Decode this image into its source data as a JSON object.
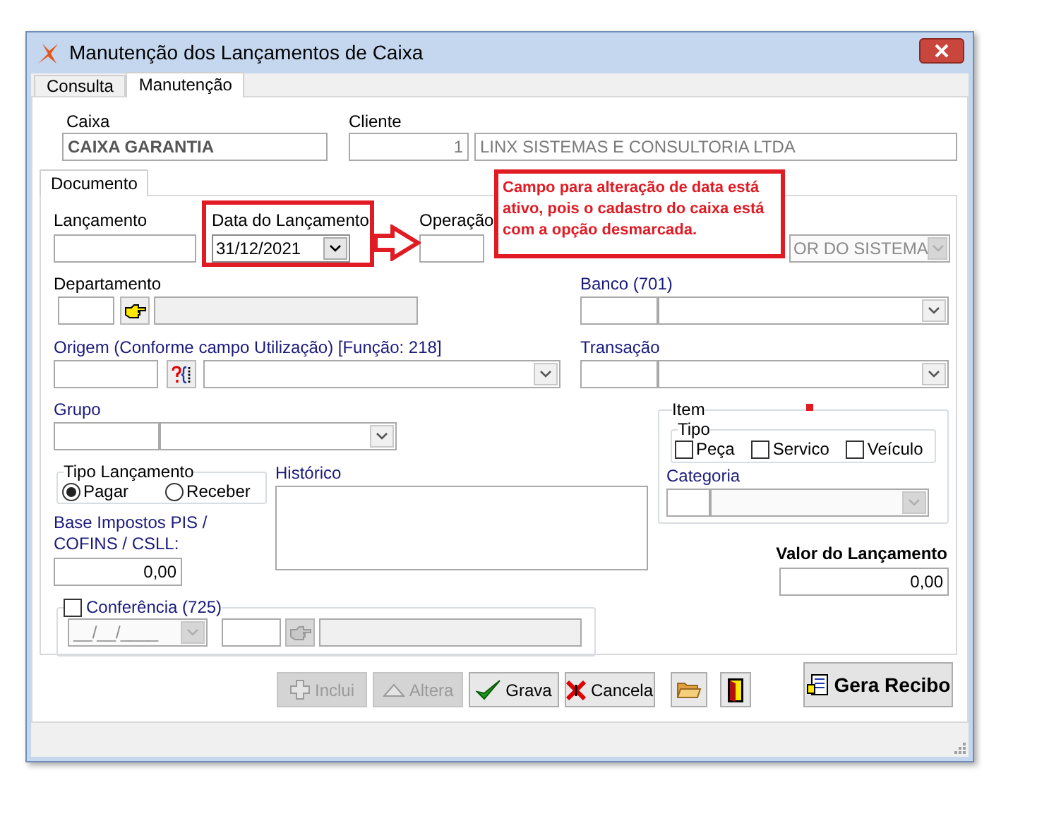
{
  "window": {
    "title": "Manutenção dos Lançamentos de Caixa"
  },
  "tabs": [
    {
      "label": "Consulta",
      "selected": false
    },
    {
      "label": "Manutenção",
      "selected": true
    }
  ],
  "caixa": {
    "label": "Caixa",
    "value": "CAIXA GARANTIA"
  },
  "cliente": {
    "label": "Cliente",
    "code": "1",
    "name": "LINX SISTEMAS E CONSULTORIA LTDA"
  },
  "inner_tabs": [
    {
      "label": "Documento",
      "selected": true
    }
  ],
  "lancamento": {
    "label": "Lançamento"
  },
  "data_lancamento": {
    "label": "Data do Lançamento",
    "value": "31/12/2021"
  },
  "operacao": {
    "label": "Operação",
    "value": "OR DO SISTEMA",
    "disabled": true
  },
  "departamento": {
    "label": "Departamento"
  },
  "banco": {
    "label": "Banco (701)"
  },
  "origem": {
    "label": "Origem (Conforme campo Utilização) [Função: 218]"
  },
  "transacao": {
    "label": "Transação"
  },
  "grupo": {
    "label": "Grupo"
  },
  "item": {
    "title": "Item",
    "tipo_title": "Tipo",
    "categoria_label": "Categoria",
    "categoria_disabled": true,
    "tipo": [
      {
        "label": "Peça",
        "checked": false
      },
      {
        "label": "Servico",
        "checked": false
      },
      {
        "label": "Veículo",
        "checked": false
      }
    ]
  },
  "tipo_lancamento": {
    "title": "Tipo Lançamento",
    "options": [
      {
        "label": "Pagar",
        "selected": true
      },
      {
        "label": "Receber",
        "selected": false
      }
    ]
  },
  "historico": {
    "label": "Histórico"
  },
  "base_impostos": {
    "label": "Base Impostos PIS / COFINS / CSLL:",
    "value": "0,00"
  },
  "valor": {
    "label": "Valor do Lançamento",
    "value": "0,00"
  },
  "conferencia": {
    "label": "Conferência (725)",
    "checked": false,
    "date": "__/__/____",
    "disabled": true
  },
  "buttons": [
    {
      "kind": "add",
      "label": "Inclui",
      "disabled": true
    },
    {
      "kind": "edit",
      "label": "Altera",
      "disabled": true
    },
    {
      "kind": "save",
      "label": "Grava",
      "disabled": false
    },
    {
      "kind": "cancel",
      "label": "Cancela",
      "disabled": false
    },
    {
      "kind": "open",
      "disabled": false
    },
    {
      "kind": "exit",
      "disabled": false
    }
  ],
  "gera_recibo": {
    "label": "Gera Recibo"
  },
  "callout": {
    "text": "Campo para alteração de data está ativo, pois o cadastro do caixa está com a opção desmarcada."
  }
}
